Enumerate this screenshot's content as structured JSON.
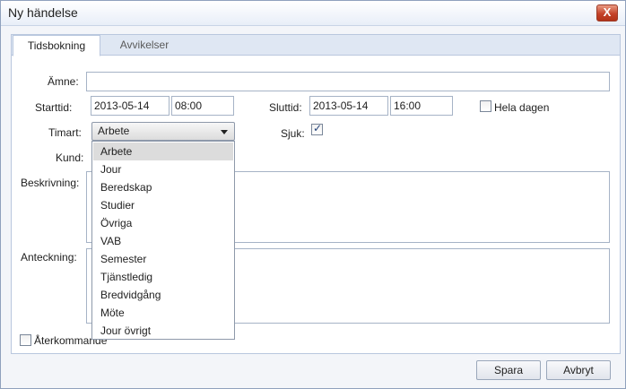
{
  "window": {
    "title": "Ny händelse",
    "close_label": "X"
  },
  "tabs": [
    {
      "label": "Tidsbokning",
      "active": true
    },
    {
      "label": "Avvikelser",
      "active": false
    }
  ],
  "form": {
    "subject_label": "Ämne:",
    "subject_value": "",
    "start_label": "Starttid:",
    "start_date": "2013-05-14",
    "start_time": "08:00",
    "end_label": "Sluttid:",
    "end_date": "2013-05-14",
    "end_time": "16:00",
    "all_day_label": "Hela dagen",
    "all_day_checked": false,
    "timart_label": "Timart:",
    "timart_value": "Arbete",
    "sick_label": "Sjuk:",
    "sick_checked": true,
    "customer_label": "Kund:",
    "description_label": "Beskrivning:",
    "note_label": "Anteckning:",
    "recurring_label": "Återkommande",
    "recurring_checked": false
  },
  "timart_options": [
    "Arbete",
    "Jour",
    "Beredskap",
    "Studier",
    "Övriga",
    "VAB",
    "Semester",
    "Tjänstledig",
    "Bredvidgång",
    "Möte",
    "Jour övrigt"
  ],
  "buttons": {
    "save": "Spara",
    "cancel": "Avbryt"
  },
  "colors": {
    "title_bar_close": "#c4432a",
    "selected_option": "#dcdcdc",
    "tab_strip": "#dfe7f3"
  }
}
